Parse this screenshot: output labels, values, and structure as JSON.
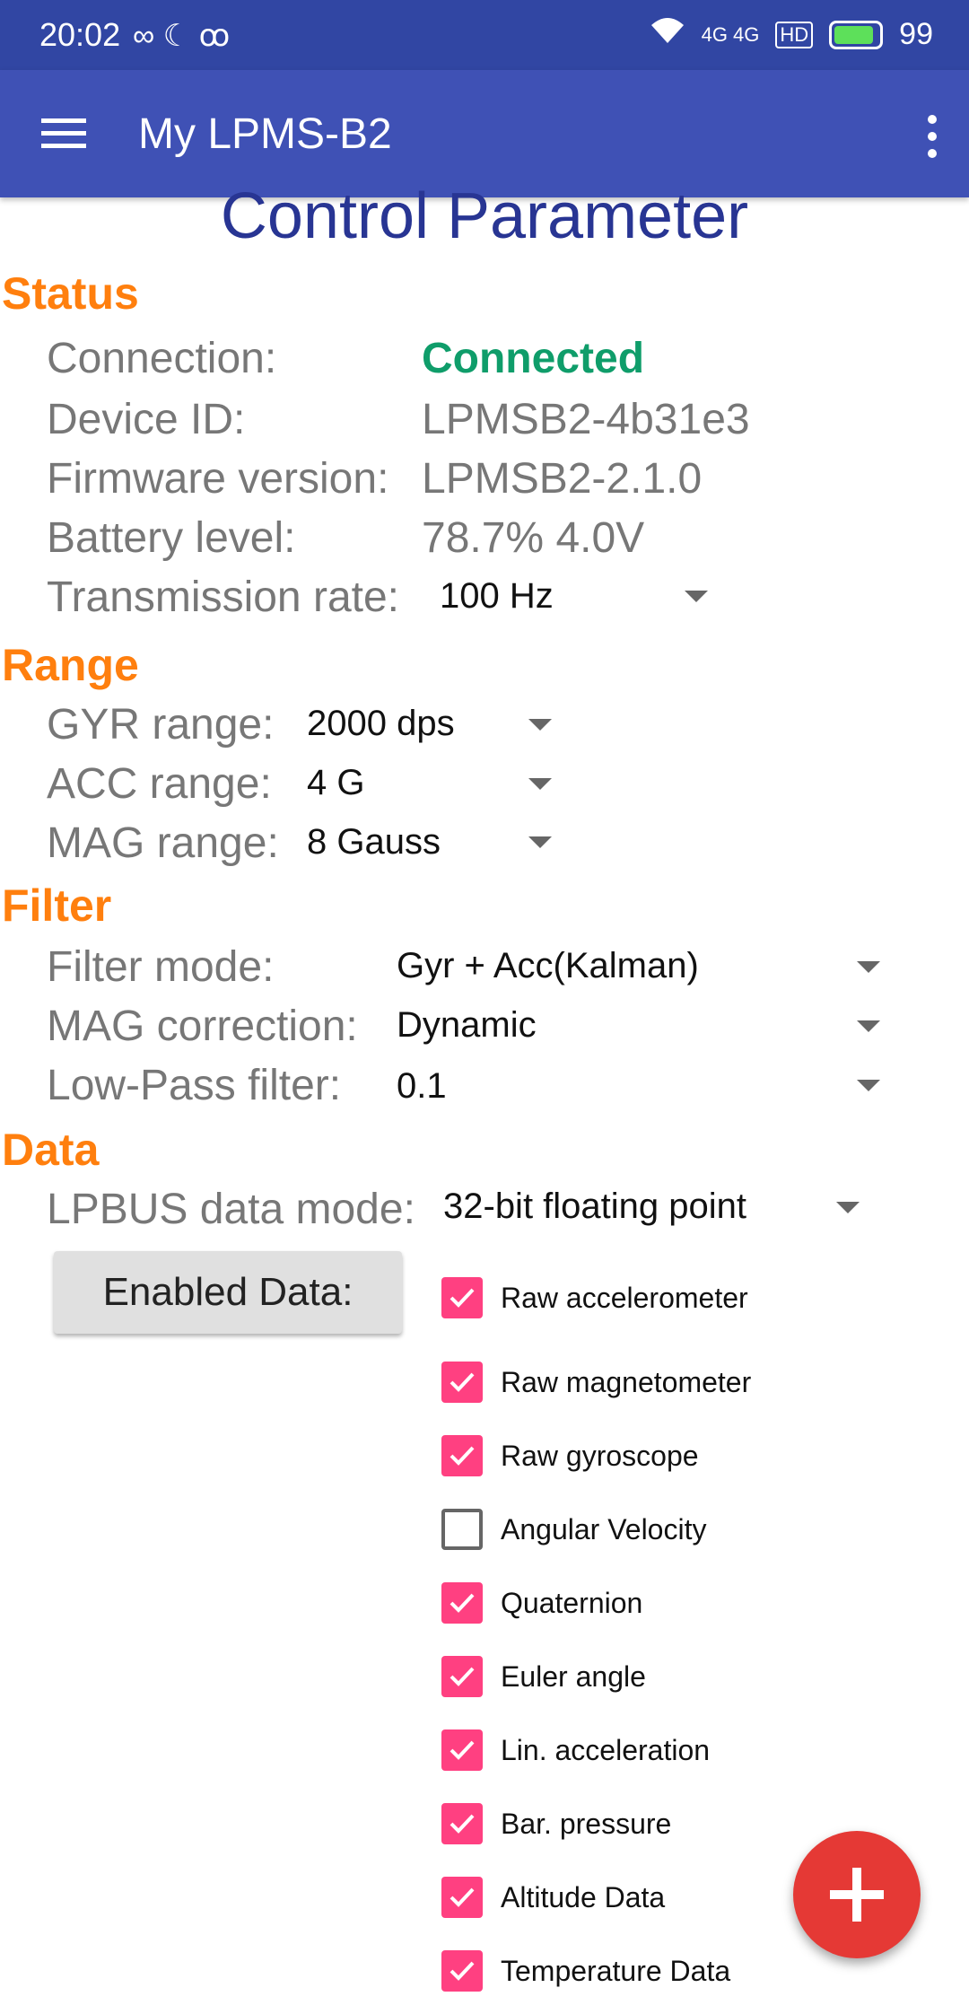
{
  "status_bar": {
    "time": "20:02",
    "left_icons": "∞ ☾ ꝏ",
    "signal": "4G 4G",
    "battery": "99"
  },
  "app_bar": {
    "title": "My LPMS-B2"
  },
  "page_title": "Control Parameter",
  "status": {
    "heading": "Status",
    "connection_label": "Connection:",
    "connection_value": "Connected",
    "device_id_label": "Device ID:",
    "device_id_value": "LPMSB2-4b31e3",
    "firmware_label": "Firmware version:",
    "firmware_value": "LPMSB2-2.1.0",
    "battery_label": "Battery level:",
    "battery_value": "78.7%  4.0V",
    "transmission_label": "Transmission rate:",
    "transmission_value": "100 Hz"
  },
  "range": {
    "heading": "Range",
    "gyr_label": "GYR range:",
    "gyr_value": "2000 dps",
    "acc_label": "ACC range:",
    "acc_value": "4 G",
    "mag_label": "MAG range:",
    "mag_value": "8 Gauss"
  },
  "filter": {
    "heading": "Filter",
    "mode_label": "Filter mode:",
    "mode_value": "Gyr + Acc(Kalman)",
    "mag_corr_label": "MAG correction:",
    "mag_corr_value": "Dynamic",
    "lowpass_label": "Low-Pass filter:",
    "lowpass_value": "0.1"
  },
  "data": {
    "heading": "Data",
    "mode_label": "LPBUS data mode:",
    "mode_value": "32-bit floating point",
    "enabled_button": "Enabled Data:",
    "items": [
      {
        "label": "Raw accelerometer",
        "checked": true
      },
      {
        "label": "Raw magnetometer",
        "checked": true
      },
      {
        "label": "Raw gyroscope",
        "checked": true
      },
      {
        "label": "Angular Velocity",
        "checked": false
      },
      {
        "label": "Quaternion",
        "checked": true
      },
      {
        "label": "Euler angle",
        "checked": true
      },
      {
        "label": "Lin. acceleration",
        "checked": true
      },
      {
        "label": "Bar. pressure",
        "checked": true
      },
      {
        "label": "Altitude Data",
        "checked": true
      },
      {
        "label": "Temperature Data",
        "checked": true
      }
    ]
  },
  "colors": {
    "app_bar": "#3f51b5",
    "section_heading": "#ff7f0e",
    "connected": "#0f9d6a",
    "checkbox": "#ff4081",
    "fab": "#e53935"
  }
}
